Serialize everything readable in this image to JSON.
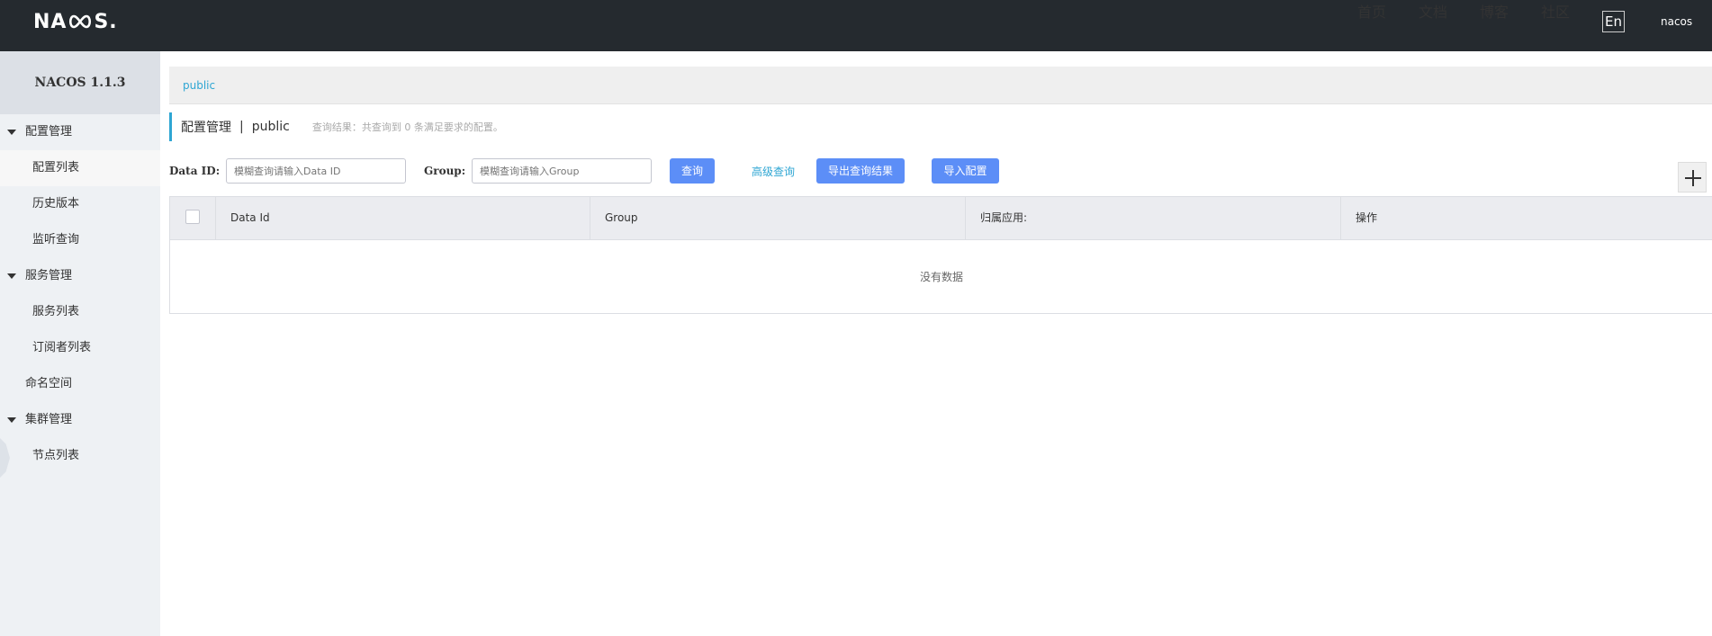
{
  "header": {
    "logo_text_left": "NA",
    "logo_text_right": "S.",
    "nav": [
      "首页",
      "文档",
      "博客",
      "社区"
    ],
    "lang": "En",
    "user": "nacos"
  },
  "sidebar": {
    "brand": "NACOS 1.1.3",
    "groups": [
      {
        "label": "配置管理",
        "items": [
          "配置列表",
          "历史版本",
          "监听查询"
        ]
      },
      {
        "label": "服务管理",
        "items": [
          "服务列表",
          "订阅者列表"
        ]
      },
      {
        "label": "命名空间"
      },
      {
        "label": "集群管理",
        "items": [
          "节点列表"
        ]
      }
    ]
  },
  "main": {
    "namespace_tab": "public",
    "title": "配置管理",
    "separator": "|",
    "namespace": "public",
    "result_text": "查询结果：共查询到 0 条满足要求的配置。",
    "search": {
      "dataid_label": "Data ID:",
      "dataid_placeholder": "模糊查询请输入Data ID",
      "group_label": "Group:",
      "group_placeholder": "模糊查询请输入Group",
      "query_button": "查询",
      "advanced_link": "高级查询",
      "export_button": "导出查询结果",
      "import_button": "导入配置"
    },
    "table": {
      "columns": [
        "Data Id",
        "Group",
        "归属应用:",
        "操作"
      ],
      "empty": "没有数据"
    }
  },
  "colors": {
    "topbar": "#252a2f",
    "accent": "#2ea6d3",
    "primary_button": "#5c8ef7"
  }
}
